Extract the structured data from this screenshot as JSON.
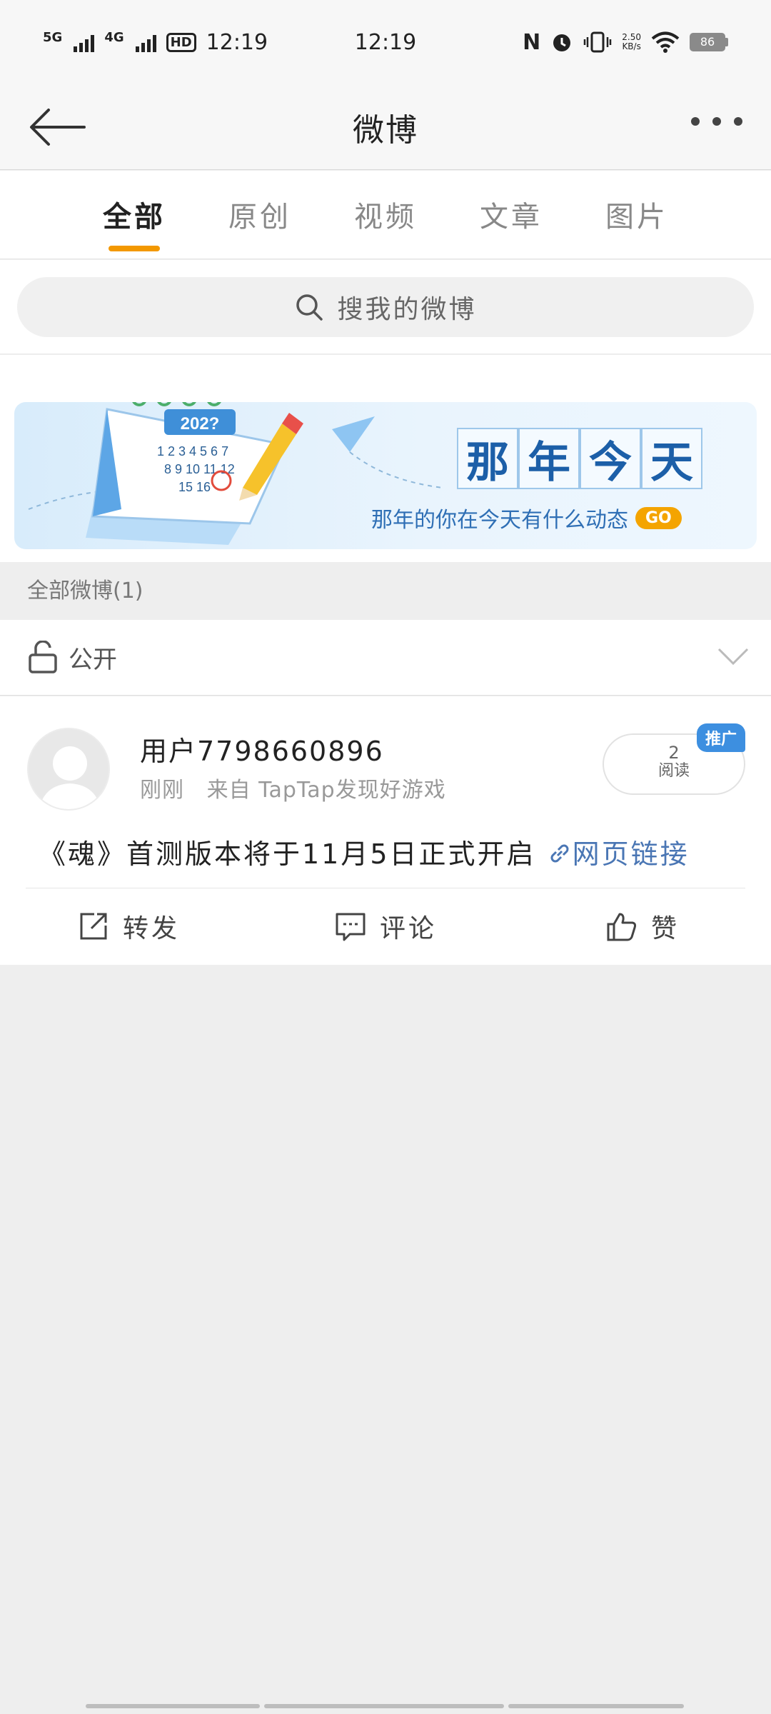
{
  "status_bar": {
    "signal1": "5G",
    "signal2": "4G",
    "hd": "HD",
    "time_left": "12:19",
    "time_center": "12:19",
    "net_speed": "2.50",
    "net_unit": "KB/s",
    "battery": "86"
  },
  "nav": {
    "title": "微博"
  },
  "tabs": [
    {
      "label": "全部",
      "active": true
    },
    {
      "label": "原创",
      "active": false
    },
    {
      "label": "视频",
      "active": false
    },
    {
      "label": "文章",
      "active": false
    },
    {
      "label": "图片",
      "active": false
    }
  ],
  "search": {
    "placeholder": "搜我的微博"
  },
  "banner": {
    "title_chars": [
      "那",
      "年",
      "今",
      "天"
    ],
    "subtitle": "那年的你在今天有什么动态",
    "go_label": "GO",
    "calendar_year": "202?"
  },
  "section": {
    "header": "全部微博(1)"
  },
  "visibility": {
    "label": "公开"
  },
  "post": {
    "username": "用户7798660896",
    "time": "刚刚",
    "source": "来自 TapTap发现好游戏",
    "reads_count": "2",
    "reads_label": "阅读",
    "promo_badge": "推广",
    "text": "《魂》首测版本将于11月5日正式开启",
    "link_label": "网页链接",
    "actions": {
      "repost": "转发",
      "comment": "评论",
      "like": "赞"
    }
  },
  "colors": {
    "accent": "#f39800",
    "link": "#4a76b4",
    "banner_title": "#1c5fa8",
    "promo": "#3d8fe0"
  }
}
